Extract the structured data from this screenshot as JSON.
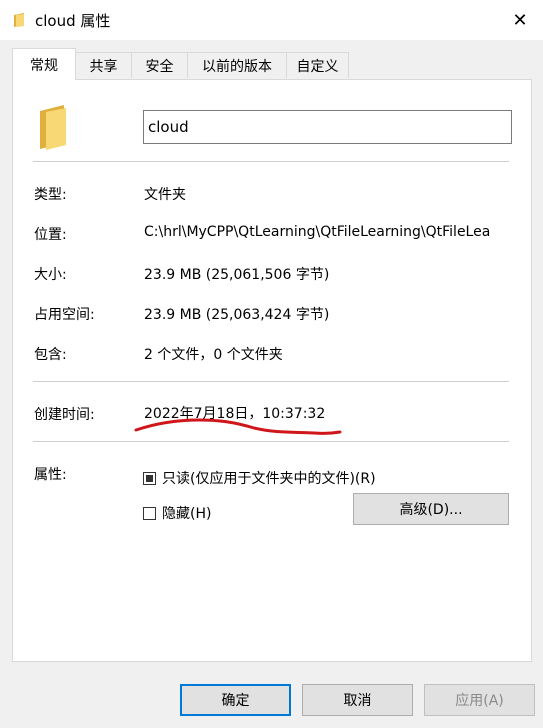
{
  "window": {
    "title": "cloud 属性",
    "close_symbol": "✕"
  },
  "tabs": [
    {
      "label": "常规",
      "active": true
    },
    {
      "label": "共享"
    },
    {
      "label": "安全"
    },
    {
      "label": "以前的版本"
    },
    {
      "label": "自定义"
    }
  ],
  "general": {
    "name_value": "cloud",
    "type": {
      "label": "类型:",
      "value": "文件夹"
    },
    "location": {
      "label": "位置:",
      "value": "C:\\hrl\\MyCPP\\QtLearning\\QtFileLearning\\QtFileLea"
    },
    "size": {
      "label": "大小:",
      "value": "23.9 MB (25,061,506 字节)"
    },
    "size_on_disk": {
      "label": "占用空间:",
      "value": "23.9 MB (25,063,424 字节)"
    },
    "contains": {
      "label": "包含:",
      "value": "2 个文件，0 个文件夹"
    },
    "created": {
      "label": "创建时间:",
      "value": "2022年7月18日，10:37:32"
    },
    "attributes": {
      "label": "属性:",
      "readonly_label": "只读(仅应用于文件夹中的文件)(R)",
      "readonly_state": "indeterminate",
      "hidden_label": "隐藏(H)",
      "hidden_checked": false,
      "advanced_button": "高级(D)..."
    }
  },
  "footer": {
    "ok": "确定",
    "cancel": "取消",
    "apply": "应用(A)"
  },
  "colors": {
    "folder_yellow": "#f8d775",
    "folder_dark": "#e0b03c",
    "annotation_red": "#d0161b",
    "default_button_border": "#0078d7"
  },
  "icons": {
    "title": "folder-icon",
    "large": "folder-icon",
    "close": "close-icon"
  }
}
